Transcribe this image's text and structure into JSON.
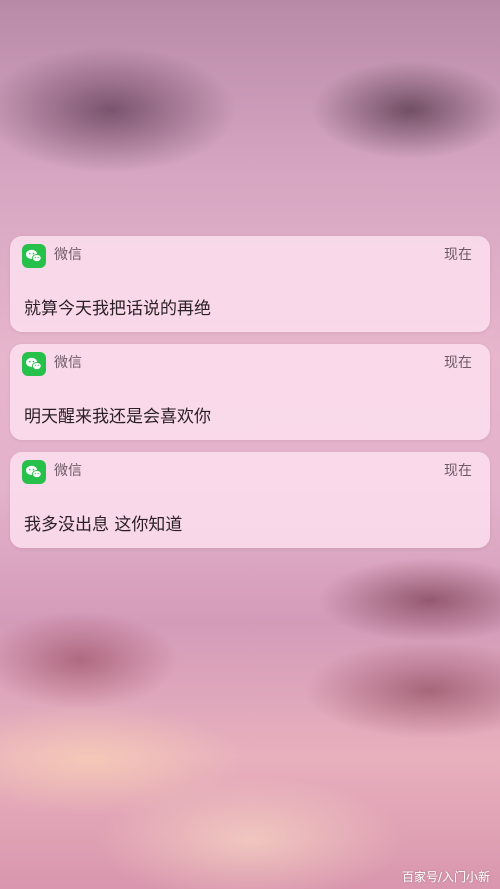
{
  "notifications": [
    {
      "app_name": "微信",
      "app_icon": "wechat-icon",
      "time": "现在",
      "message": "就算今天我把话说的再绝"
    },
    {
      "app_name": "微信",
      "app_icon": "wechat-icon",
      "time": "现在",
      "message": "明天醒来我还是会喜欢你"
    },
    {
      "app_name": "微信",
      "app_icon": "wechat-icon",
      "time": "现在",
      "message": "我多没出息 这你知道"
    }
  ],
  "watermark": "百家号/入门小新",
  "colors": {
    "wechat_green": "#27c04a",
    "card_background": "#ffe4f2"
  }
}
